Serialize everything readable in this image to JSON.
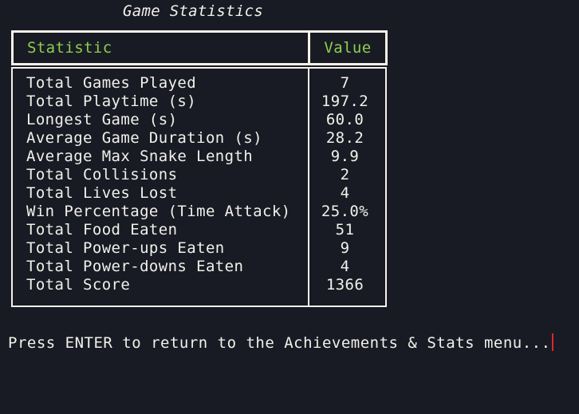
{
  "title": "Game Statistics",
  "table": {
    "headers": {
      "statistic": "Statistic",
      "value": "Value"
    },
    "rows": [
      {
        "label": "Total Games Played",
        "value": "7"
      },
      {
        "label": "Total Playtime (s)",
        "value": "197.2"
      },
      {
        "label": "Longest Game (s)",
        "value": "60.0"
      },
      {
        "label": "Average Game Duration (s)",
        "value": "28.2"
      },
      {
        "label": "Average Max Snake Length",
        "value": "9.9"
      },
      {
        "label": "Total Collisions",
        "value": "2"
      },
      {
        "label": "Total Lives Lost",
        "value": "4"
      },
      {
        "label": "Win Percentage (Time Attack)",
        "value": "25.0%"
      },
      {
        "label": "Total Food Eaten",
        "value": "51"
      },
      {
        "label": "Total Power-ups Eaten",
        "value": "9"
      },
      {
        "label": "Total Power-downs Eaten",
        "value": "4"
      },
      {
        "label": "Total Score",
        "value": "1366"
      }
    ]
  },
  "prompt": "Press ENTER to return to the Achievements & Stats menu...",
  "colors": {
    "background": "#181b24",
    "header_text": "#8fce4f",
    "border": "#f6f1e8",
    "text": "#f2f0ea",
    "cursor": "#e0242e"
  }
}
